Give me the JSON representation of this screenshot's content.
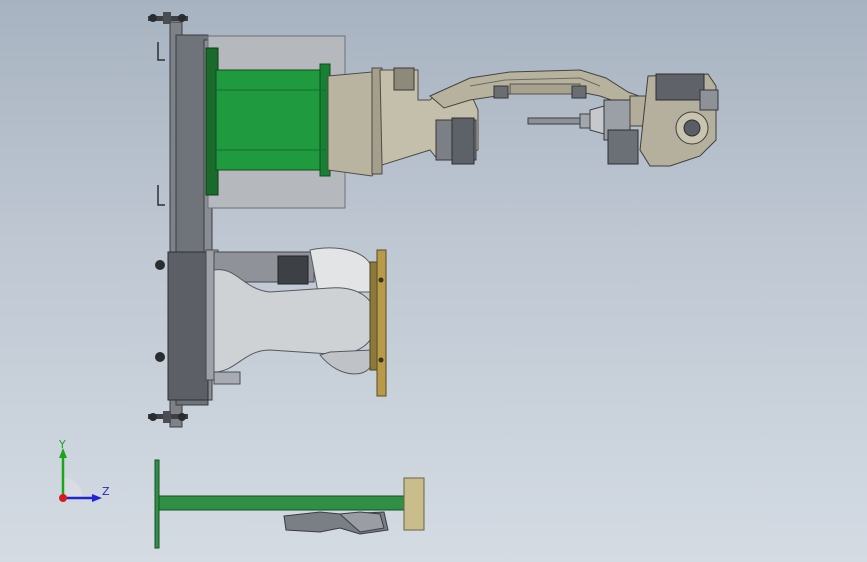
{
  "viewport": {
    "background_top": "#a8b3c1",
    "background_bottom": "#d4dbe3"
  },
  "colors": {
    "motor_green": "#1f9a3e",
    "plate_green": "#2f8f45",
    "steel_gray": "#8f9399",
    "dark_gray": "#5d6168",
    "base_plate": "#6f737a",
    "panel_gray": "#b5b8bc",
    "casting_light": "#cfd2d5",
    "brass": "#b89a4a",
    "tan_block": "#c9bd8c"
  },
  "triad": {
    "axis_y_label": "Y",
    "axis_z_label": "Z",
    "y_color": "#1aa51a",
    "z_color": "#2323d6",
    "x_color": "#d61a1a"
  }
}
